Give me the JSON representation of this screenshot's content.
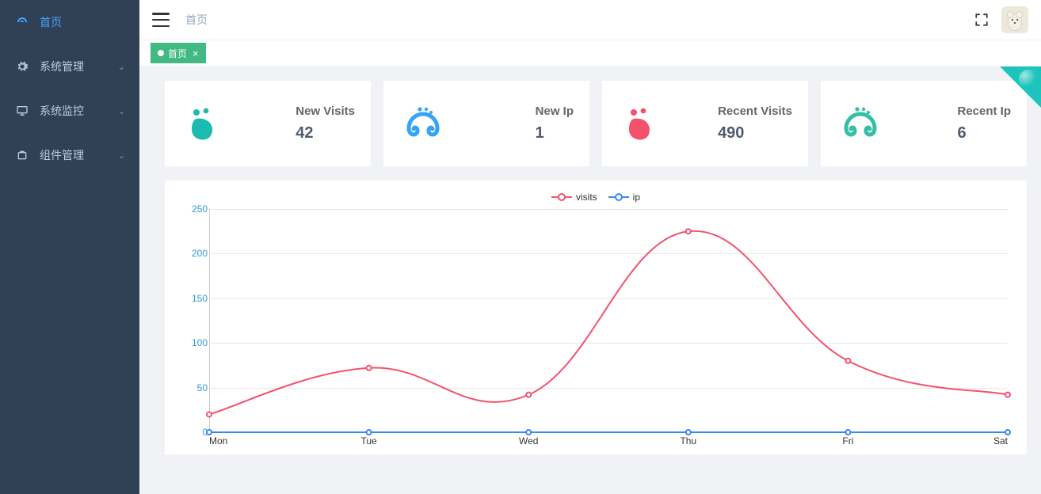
{
  "sidebar": {
    "items": [
      {
        "label": "首页",
        "icon": "dashboard-icon",
        "active": true,
        "expandable": false
      },
      {
        "label": "系统管理",
        "icon": "gear-icon",
        "active": false,
        "expandable": true
      },
      {
        "label": "系统监控",
        "icon": "monitor-icon",
        "active": false,
        "expandable": true
      },
      {
        "label": "组件管理",
        "icon": "component-icon",
        "active": false,
        "expandable": true
      }
    ]
  },
  "header": {
    "breadcrumb": "首页"
  },
  "tabs": [
    {
      "label": "首页",
      "closable": true,
      "active": true
    }
  ],
  "cards": [
    {
      "label": "New Visits",
      "value": "42",
      "icon": "foot-icon",
      "color": "#1bbbb0"
    },
    {
      "label": "New Ip",
      "value": "1",
      "icon": "swirl-foot-icon",
      "color": "#36a3f7"
    },
    {
      "label": "Recent Visits",
      "value": "490",
      "icon": "foot-icon",
      "color": "#f4516c"
    },
    {
      "label": "Recent Ip",
      "value": "6",
      "icon": "swirl-foot-icon",
      "color": "#34bfa3"
    }
  ],
  "chart_data": {
    "type": "line",
    "title": "",
    "xlabel": "",
    "ylabel": "",
    "ylim": [
      0,
      250
    ],
    "yticks": [
      0,
      50,
      100,
      150,
      200,
      250
    ],
    "categories": [
      "Mon",
      "Tue",
      "Wed",
      "Thu",
      "Fri",
      "Sat"
    ],
    "series": [
      {
        "name": "visits",
        "color": "#f4516c",
        "values": [
          20,
          72,
          42,
          225,
          80,
          42
        ]
      },
      {
        "name": "ip",
        "color": "#3888fa",
        "values": [
          0,
          0,
          0,
          0,
          0,
          0
        ]
      }
    ],
    "legend_position": "top"
  }
}
